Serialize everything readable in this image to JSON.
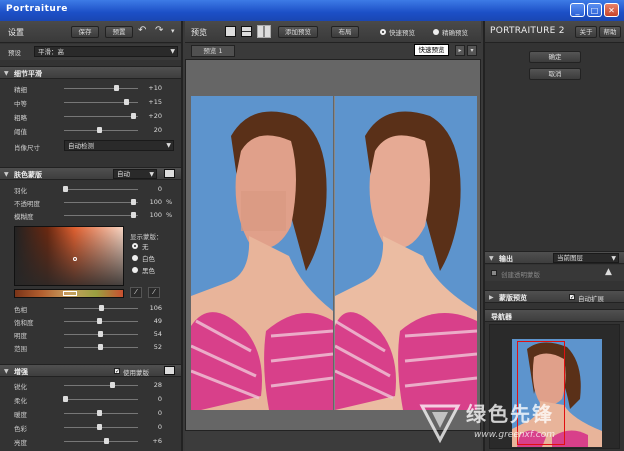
{
  "window": {
    "title": "Portraiture",
    "min": "_",
    "max": "□",
    "close": "✕"
  },
  "settings": {
    "title": "设置",
    "save": "保存",
    "preset": "预置",
    "undo": "↶",
    "redo": "↷",
    "more": "▾",
    "preset_label": "预设",
    "preset_value": "平滑：高"
  },
  "detail": {
    "title": "细节平滑",
    "rows": [
      {
        "label": "精细",
        "value": "+10",
        "level": 0.72
      },
      {
        "label": "中等",
        "value": "+15",
        "level": 0.86
      },
      {
        "label": "粗略",
        "value": "+20",
        "level": 0.96
      },
      {
        "label": "阈值",
        "value": "20",
        "level": 0.48
      }
    ],
    "spot_label": "肖像尺寸",
    "spot_value": "自动检测"
  },
  "skin": {
    "title": "肤色蒙版",
    "mode": "自动",
    "rows": [
      {
        "label": "羽化",
        "value": "0",
        "unit": "",
        "level": 0.02
      },
      {
        "label": "不透明度",
        "value": "100",
        "unit": "%",
        "level": 0.96
      },
      {
        "label": "模糊度",
        "value": "100",
        "unit": "%",
        "level": 0.96
      }
    ],
    "show_mask_label": "显示蒙版：",
    "options": [
      "无",
      "白色",
      "黑色"
    ],
    "color_rows": [
      {
        "label": "色相",
        "value": "106",
        "level": 0.52
      },
      {
        "label": "饱和度",
        "value": "49",
        "level": 0.48
      },
      {
        "label": "明度",
        "value": "54",
        "level": 0.5
      },
      {
        "label": "范围",
        "value": "52",
        "level": 0.5
      }
    ]
  },
  "enhance": {
    "title": "增强",
    "use_mask": "使用蒙版",
    "rows": [
      {
        "label": "锐化",
        "value": "28",
        "level": 0.66
      },
      {
        "label": "柔化",
        "value": "0",
        "level": 0.02
      },
      {
        "label": "暖度",
        "value": "0",
        "level": 0.48
      },
      {
        "label": "色彩",
        "value": "0",
        "level": 0.48
      },
      {
        "label": "亮度",
        "value": "+6",
        "level": 0.58
      }
    ]
  },
  "preview": {
    "title": "预览",
    "add_preview": "添加预览",
    "layout": "布局",
    "fast": "快速预览",
    "precise": "精确预览",
    "tooltip": "快速预览",
    "tab": "预览 1"
  },
  "right": {
    "brand_main": "PORTRAIT",
    "brand_suffix": "URE 2",
    "about": "关于",
    "help": "帮助",
    "ok": "确定",
    "cancel": "取消",
    "output_title": "输出",
    "output_value": "当前图层",
    "create_mask": "创建透明蒙版",
    "mask_preview": "蒙版预览",
    "auto_expand": "自动扩展",
    "navigator": "导航器"
  },
  "watermark": {
    "brand": "绿色先锋",
    "url": "www.greenxf.com"
  }
}
